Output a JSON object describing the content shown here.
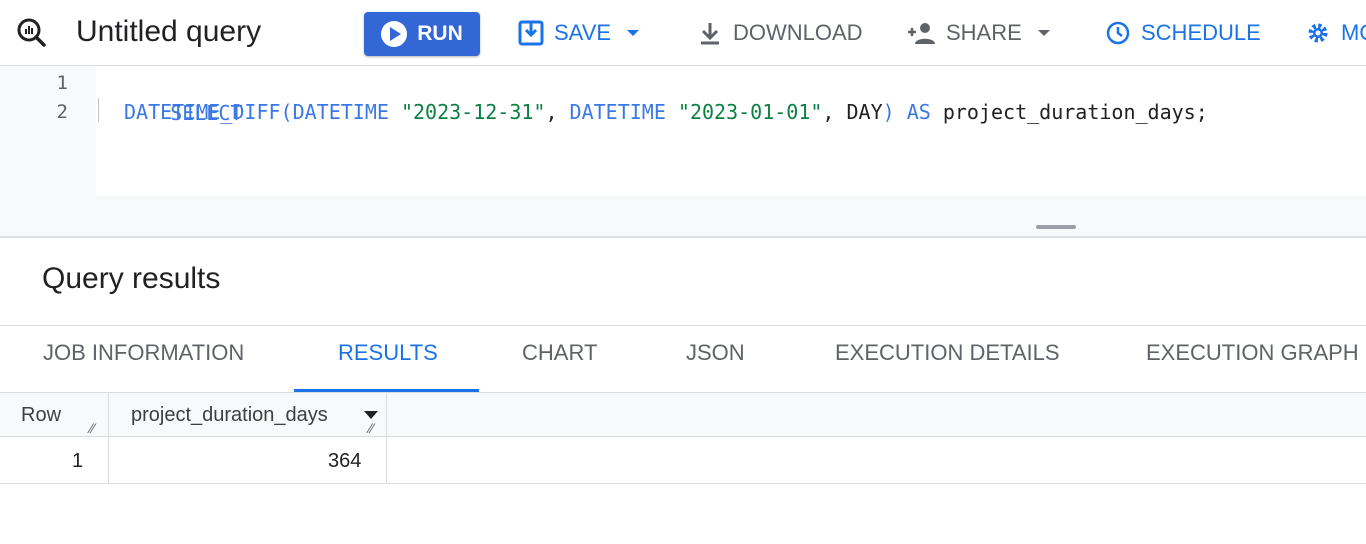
{
  "toolbar": {
    "title": "Untitled query",
    "run_label": "RUN",
    "save_label": "SAVE",
    "download_label": "DOWNLOAD",
    "share_label": "SHARE",
    "schedule_label": "SCHEDULE",
    "more_label": "MO"
  },
  "editor": {
    "line_numbers": [
      "1",
      "2"
    ],
    "line1": {
      "keyword": "SELECT"
    },
    "line2": {
      "fn": "DATETIME_DIFF(",
      "dt1_kw": "DATETIME",
      "dt1_val": "\"2023-12-31\"",
      "comma1": ", ",
      "dt2_kw": "DATETIME",
      "dt2_val": "\"2023-01-01\"",
      "comma2": ", DAY",
      "close": ")",
      "as_kw": " AS",
      "alias": " project_duration_days;"
    }
  },
  "results": {
    "title": "Query results",
    "tabs": [
      "JOB INFORMATION",
      "RESULTS",
      "CHART",
      "JSON",
      "EXECUTION DETAILS",
      "EXECUTION GRAPH"
    ],
    "active_tab": "RESULTS",
    "columns": [
      "Row",
      "project_duration_days"
    ],
    "rows": [
      {
        "row": "1",
        "project_duration_days": "364"
      }
    ]
  },
  "colors": {
    "accent": "#1a73e8",
    "run_button": "#3367d6",
    "keyword": "#3b78e7",
    "string": "#0b8043"
  },
  "icons": {
    "query": "query-search-icon",
    "run": "play-icon",
    "save": "save-icon",
    "download": "download-icon",
    "share": "share-person-icon",
    "schedule": "clock-icon",
    "more": "gear-icon"
  }
}
